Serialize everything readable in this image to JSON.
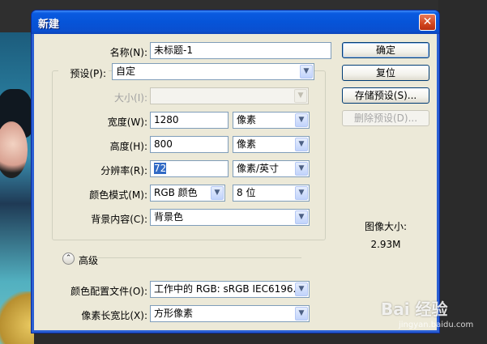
{
  "window": {
    "title": "新建",
    "close_symbol": "✕"
  },
  "form": {
    "name": {
      "label": "名称(N):",
      "value": "未标题-1"
    },
    "preset": {
      "label": "预设(P):",
      "value": "自定"
    },
    "size": {
      "label": "大小(I):",
      "value": ""
    },
    "width": {
      "label": "宽度(W):",
      "value": "1280",
      "unit": "像素"
    },
    "height": {
      "label": "高度(H):",
      "value": "800",
      "unit": "像素"
    },
    "resolution": {
      "label": "分辨率(R):",
      "value": "72",
      "unit": "像素/英寸"
    },
    "color_mode": {
      "label": "颜色模式(M):",
      "value": "RGB 颜色",
      "depth": "8 位"
    },
    "background": {
      "label": "背景内容(C):",
      "value": "背景色"
    },
    "advanced": {
      "label": "高级",
      "toggle_symbol": "⌃"
    },
    "color_profile": {
      "label": "颜色配置文件(O):",
      "value": "工作中的 RGB: sRGB IEC6196..."
    },
    "pixel_aspect": {
      "label": "像素长宽比(X):",
      "value": "方形像素"
    }
  },
  "buttons": {
    "ok": "确定",
    "reset": "复位",
    "save_preset": "存储预设(S)...",
    "delete_preset": "删除预设(D)..."
  },
  "info": {
    "image_size_label": "图像大小:",
    "image_size_value": "2.93M"
  },
  "watermark": {
    "brand": "Bai 经验",
    "url": "jingyan.baidu.com"
  },
  "icons": {
    "dropdown": "▼"
  },
  "colors": {
    "titlebar": "#0654d8",
    "client": "#ece9d8",
    "selection": "#316ac5"
  }
}
